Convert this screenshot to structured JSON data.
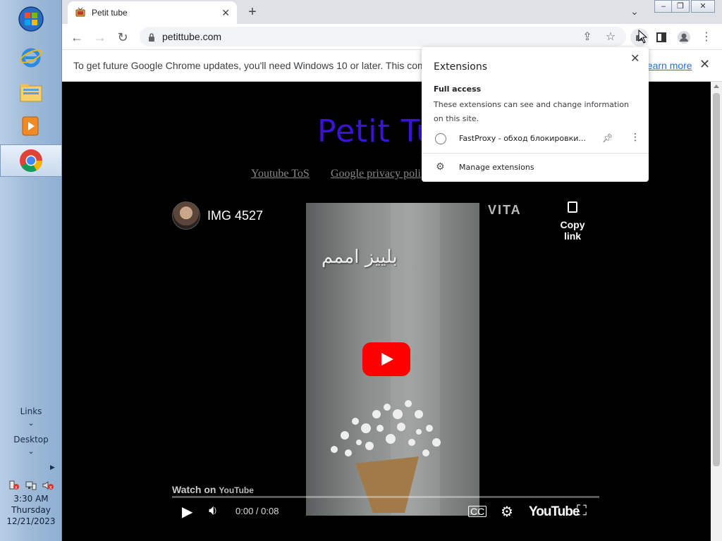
{
  "taskbar": {
    "links_label": "Links",
    "desktop_label": "Desktop",
    "clock": {
      "time": "3:30 AM",
      "day": "Thursday",
      "date": "12/21/2023"
    }
  },
  "browser": {
    "tab": {
      "title": "Petit tube"
    },
    "omnibox": {
      "url": "petittube.com"
    },
    "infobar": {
      "message": "To get future Google Chrome updates, you'll need Windows 10 or later. This computer",
      "learn_more": "Learn more"
    }
  },
  "page": {
    "site_title": "Petit Tu",
    "links": [
      "Youtube ToS",
      "Google privacy poli"
    ],
    "player": {
      "video_title": "IMG 4527",
      "overlay_text": "بلييز اممم",
      "watermark": "VITA",
      "copy_link": "Copy link",
      "watch_on": "Watch on",
      "youtube_small": "YouTube",
      "time": "0:00 / 0:08",
      "youtube_logo": "YouTube"
    }
  },
  "extensions_popup": {
    "title": "Extensions",
    "section": "Full access",
    "description": "These extensions can see and change information on this site.",
    "item": "FastProxy - обход блокировки...",
    "manage": "Manage extensions"
  },
  "colors": {
    "title_purple": "#3a12d8",
    "yt_red": "#ff0000",
    "link_blue": "#1a73e8"
  }
}
